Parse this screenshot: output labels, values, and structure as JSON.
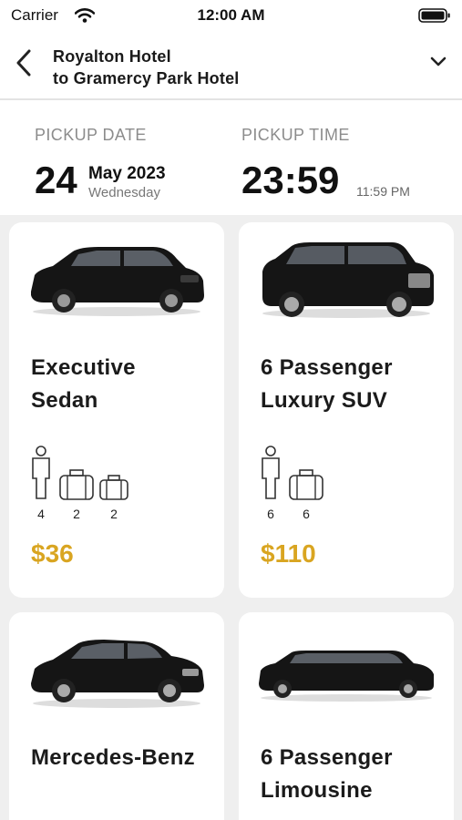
{
  "status_bar": {
    "carrier": "Carrier",
    "time": "12:00 AM"
  },
  "nav": {
    "from": "Royalton Hotel",
    "to": "to Gramercy Park Hotel"
  },
  "pickup": {
    "date_label": "PICKUP DATE",
    "day": "24",
    "month_year": "May 2023",
    "weekday": "Wednesday",
    "time_label": "PICKUP TIME",
    "time": "23:59",
    "time_12h": "11:59 PM"
  },
  "vehicles": [
    {
      "name_line1": "Executive",
      "name_line2": "Sedan",
      "passengers": "4",
      "large_bags": "2",
      "small_bags": "2",
      "price": "$36",
      "icon": "sedan-car-image"
    },
    {
      "name_line1": "6 Passenger",
      "name_line2": "Luxury SUV",
      "passengers": "6",
      "large_bags": "6",
      "price": "$110",
      "icon": "suv-car-image"
    },
    {
      "name_line1": "Mercedes-Benz",
      "name_line2": "",
      "icon": "mercedes-car-image"
    },
    {
      "name_line1": "6 Passenger",
      "name_line2": "Limousine",
      "icon": "limousine-car-image"
    }
  ],
  "colors": {
    "price": "#d9a521",
    "background": "#efefef",
    "card": "#ffffff"
  }
}
